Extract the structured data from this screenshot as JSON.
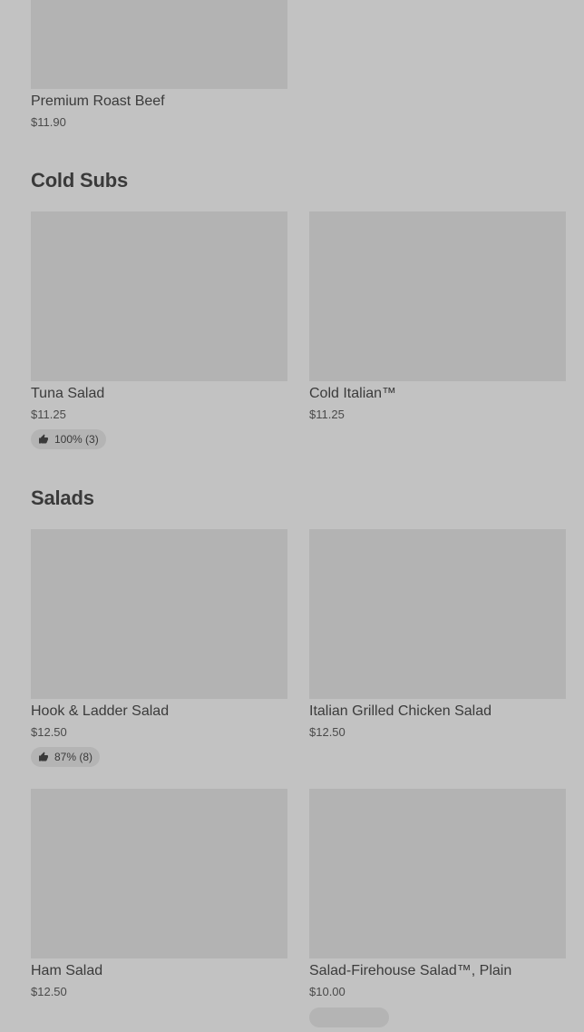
{
  "sections": [
    {
      "title": ""
    },
    {
      "title": "Cold Subs"
    },
    {
      "title": "Salads"
    }
  ],
  "items": {
    "premium_roast_beef": {
      "name": "Premium Roast Beef",
      "price": "$11.90"
    },
    "tuna_salad": {
      "name": "Tuna Salad",
      "price": "$11.25",
      "rating": "100% (3)"
    },
    "cold_italian": {
      "name": "Cold Italian™",
      "price": "$11.25"
    },
    "hook_ladder_salad": {
      "name": "Hook & Ladder Salad",
      "price": "$12.50",
      "rating": "87% (8)"
    },
    "italian_grilled_chicken_salad": {
      "name": "Italian Grilled Chicken Salad",
      "price": "$12.50"
    },
    "ham_salad": {
      "name": "Ham Salad",
      "price": "$12.50"
    },
    "firehouse_salad_plain": {
      "name": "Salad-Firehouse Salad™, Plain",
      "price": "$10.00"
    }
  },
  "icons": {
    "rating": "thumbs-up-icon"
  },
  "colors": {
    "background": "#c2c2c2",
    "image_placeholder": "#b3b3b3",
    "badge": "#b4b4b4"
  }
}
